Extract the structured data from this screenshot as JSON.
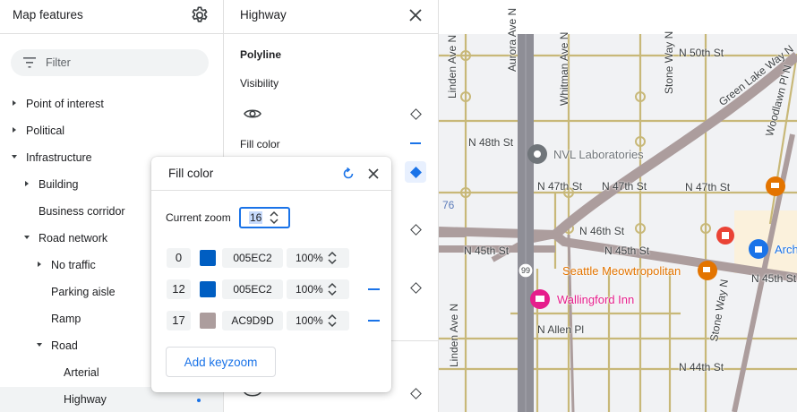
{
  "features_panel": {
    "title": "Map features",
    "settings_icon": "gear-icon",
    "filter_placeholder": "Filter",
    "tree": [
      {
        "label": "Point of interest",
        "caret": "right"
      },
      {
        "label": "Political",
        "caret": "right"
      },
      {
        "label": "Infrastructure",
        "caret": "down"
      },
      {
        "label": "Building",
        "caret": "right"
      },
      {
        "label": "Business corridor",
        "caret": ""
      },
      {
        "label": "Road network",
        "caret": "down"
      },
      {
        "label": "No traffic",
        "caret": "right"
      },
      {
        "label": "Parking aisle",
        "caret": ""
      },
      {
        "label": "Ramp",
        "caret": ""
      },
      {
        "label": "Road",
        "caret": "down"
      },
      {
        "label": "Arterial",
        "caret": ""
      },
      {
        "label": "Highway",
        "caret": "",
        "selected": true
      }
    ]
  },
  "style_panel": {
    "title": "Highway",
    "section": "Polyline",
    "visibility_label": "Visibility",
    "fill_color_label": "Fill color"
  },
  "fill_popup": {
    "title": "Fill color",
    "current_zoom_label": "Current zoom",
    "current_zoom": "16",
    "stops": [
      {
        "zoom": "0",
        "color": "#005EC2",
        "hex": "005EC2",
        "opacity": "100%",
        "removable": false
      },
      {
        "zoom": "12",
        "color": "#005EC2",
        "hex": "005EC2",
        "opacity": "100%",
        "removable": true
      },
      {
        "zoom": "17",
        "color": "#AC9D9D",
        "hex": "AC9D9D",
        "opacity": "100%",
        "removable": true
      }
    ],
    "add_keyzoom_label": "Add keyzoom"
  },
  "map": {
    "streets": [
      "N 50th St",
      "N 48th St",
      "N 47th St",
      "N 47th St",
      "N 47th St",
      "N 46th St",
      "N 45th St",
      "N 45th St",
      "N 45th St",
      "N Allen Pl",
      "N 44th St",
      "Linden Ave N",
      "Aurora Ave N",
      "Whitman Ave N",
      "Linden Ave N",
      "Stone Way N",
      "Green Lake Way N",
      "Woodlawn Pl N",
      "Stone Way N"
    ],
    "route_shield": "99",
    "edge_number": "76",
    "places": [
      {
        "name": "NVL Laboratories",
        "icon": "place-pin-icon",
        "color": "#70757a"
      },
      {
        "name": "Seattle Meowtropolitan",
        "icon": "cafe-icon",
        "color": "#e37400"
      },
      {
        "name": "Wallingford Inn",
        "icon": "hotel-icon",
        "color": "#e61e8c"
      },
      {
        "name": "Arch",
        "icon": "lock-icon",
        "color": "#1a73e8"
      }
    ],
    "colors": {
      "highway": "#ac9d9d",
      "arterial": "#c8b878",
      "aurora": "#8e8e96"
    }
  },
  "accent_color": "#1a73e8"
}
